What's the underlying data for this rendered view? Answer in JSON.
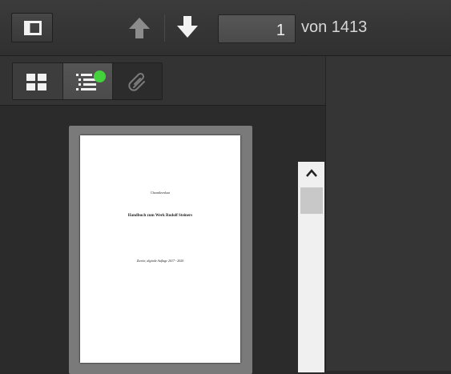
{
  "toolbar": {
    "sidebar_toggle_icon": "sidebar-toggle-icon",
    "previous_icon": "arrow-up-icon",
    "next_icon": "arrow-down-icon",
    "page_number": "1",
    "page_count_label": "von 1413"
  },
  "sidebar": {
    "views": [
      {
        "icon": "thumbnails-icon",
        "state": "default"
      },
      {
        "icon": "outline-icon",
        "state": "selected",
        "badge_color": "#43d13c"
      },
      {
        "icon": "paperclip-icon",
        "state": "disabled"
      }
    ],
    "thumbnail": {
      "line1": "Chronikverlaat",
      "line2": "Handbuch zum Werk Rudolf Steiners",
      "line3": "Zweite, digitale Auflage 2017 - 2020"
    }
  },
  "colors": {
    "toolbar_bg": "#333333",
    "accent_green": "#43d13c"
  }
}
